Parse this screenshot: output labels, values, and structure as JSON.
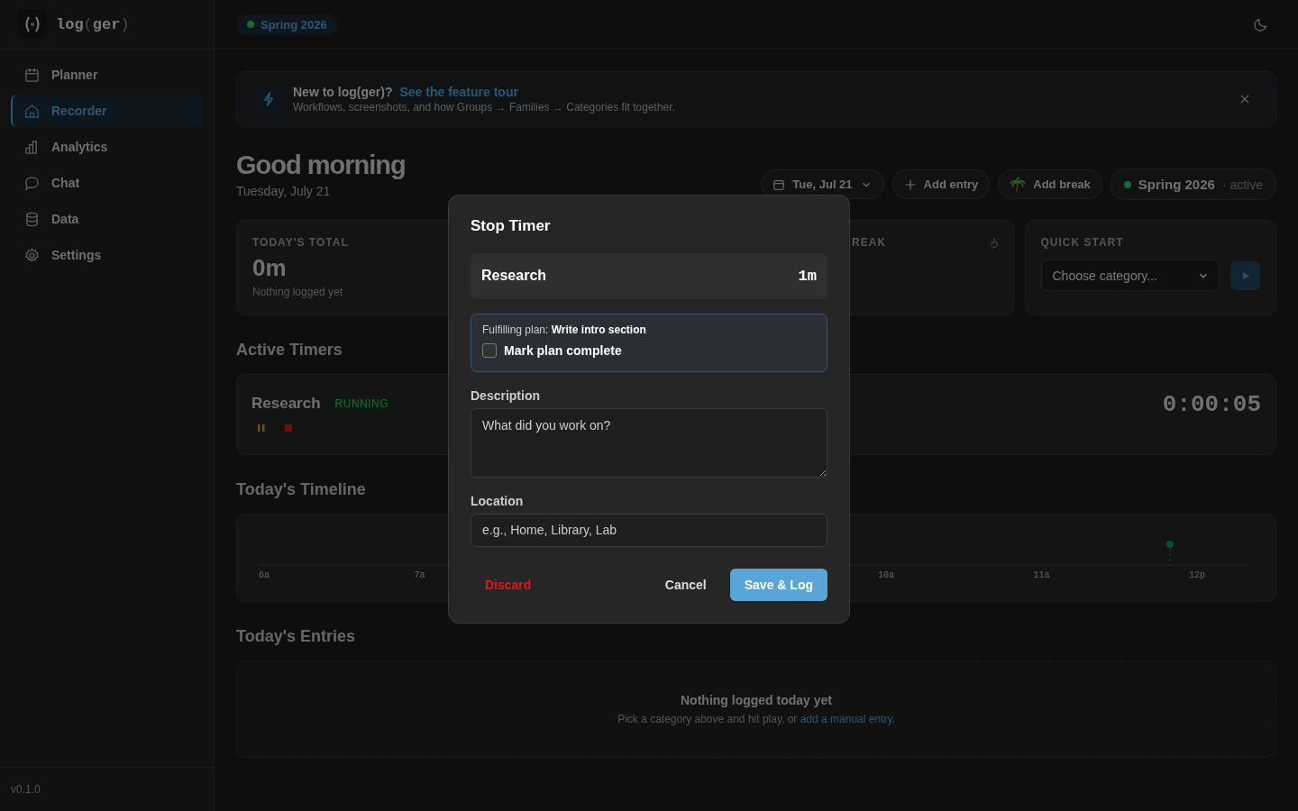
{
  "logo": {
    "word": "log",
    "open": "(",
    "inner": "ger",
    "close": ")"
  },
  "nav": [
    {
      "label": "Planner",
      "kind": "calendar",
      "selected": false
    },
    {
      "label": "Recorder",
      "kind": "home",
      "selected": true
    },
    {
      "label": "Analytics",
      "kind": "bars",
      "selected": false
    },
    {
      "label": "Chat",
      "kind": "chat",
      "selected": false
    },
    {
      "label": "Data",
      "kind": "database",
      "selected": false
    },
    {
      "label": "Settings",
      "kind": "gear",
      "selected": false
    }
  ],
  "version": "v0.1.0",
  "topbar": {
    "season": "Spring 2026"
  },
  "banner": {
    "title": "New to log(ger)?",
    "link": "See the feature tour",
    "text": "Workflows, screenshots, and how Groups → Families → Categories fit together."
  },
  "greeting": {
    "title": "Good morning",
    "date": "Tuesday, July 21"
  },
  "actions": {
    "date": "Tue, Jul 21",
    "add_entry": "Add entry",
    "add_break": "Add break",
    "season": "Spring 2026",
    "season_status": "· active"
  },
  "stats": [
    {
      "label": "TODAY'S TOTAL",
      "value": "0m",
      "note": "Nothing logged yet"
    },
    {
      "label": "REAK"
    }
  ],
  "quick_start": {
    "label": "QUICK START",
    "placeholder": "Choose category..."
  },
  "active_timers": {
    "heading": "Active Timers",
    "timers": [
      {
        "name": "Research",
        "status": "RUNNING",
        "elapsed": "0:00:05"
      }
    ]
  },
  "timeline": {
    "heading": "Today's Timeline",
    "ticks": [
      "6a",
      "7a",
      "10a",
      "11a",
      "12p"
    ]
  },
  "entries": {
    "heading": "Today's Entries",
    "empty_title": "Nothing logged today yet",
    "empty_text": "Pick a category above and hit play, or ",
    "empty_link": "add a manual entry",
    "empty_end": "."
  },
  "modal": {
    "title": "Stop Timer",
    "category": "Research",
    "duration": "1m",
    "plan_prefix": "Fulfilling plan: ",
    "plan_name": "Write intro section",
    "mark_complete": {
      "label": "Mark plan complete",
      "checked": false
    },
    "description": {
      "label": "Description",
      "placeholder": "What did you work on?"
    },
    "location": {
      "label": "Location",
      "placeholder": "e.g., Home, Library, Lab"
    },
    "discard": "Discard",
    "cancel": "Cancel",
    "save": "Save & Log"
  }
}
